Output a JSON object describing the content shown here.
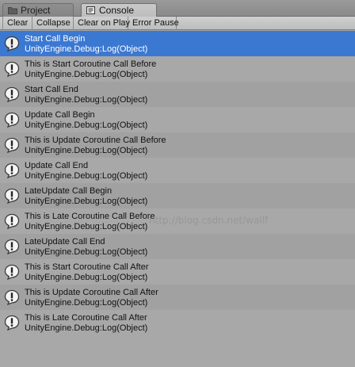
{
  "tabs": [
    {
      "label": "Project",
      "icon": "folder-icon"
    },
    {
      "label": "Console",
      "icon": "console-icon"
    }
  ],
  "toolbar": {
    "clear_label": "Clear",
    "collapse_label": "Collapse",
    "clear_on_play_label": "Clear on Play",
    "error_pause_label": "Error Pause"
  },
  "logs": [
    {
      "message": "Start Call Begin",
      "source": "UnityEngine.Debug:Log(Object)",
      "icon": "info-log-icon",
      "selected": true
    },
    {
      "message": "This is Start Coroutine Call Before",
      "source": "UnityEngine.Debug:Log(Object)",
      "icon": "info-log-icon"
    },
    {
      "message": "Start Call End",
      "source": "UnityEngine.Debug:Log(Object)",
      "icon": "info-log-icon"
    },
    {
      "message": "Update Call Begin",
      "source": "UnityEngine.Debug:Log(Object)",
      "icon": "info-log-icon"
    },
    {
      "message": "This is Update Coroutine Call Before",
      "source": "UnityEngine.Debug:Log(Object)",
      "icon": "info-log-icon"
    },
    {
      "message": "Update Call End",
      "source": "UnityEngine.Debug:Log(Object)",
      "icon": "info-log-icon"
    },
    {
      "message": "LateUpdate Call Begin",
      "source": "UnityEngine.Debug:Log(Object)",
      "icon": "info-log-icon"
    },
    {
      "message": "This is Late Coroutine Call Before",
      "source": "UnityEngine.Debug:Log(Object)",
      "icon": "info-log-icon"
    },
    {
      "message": "LateUpdate Call End",
      "source": "UnityEngine.Debug:Log(Object)",
      "icon": "info-log-icon"
    },
    {
      "message": "This is Start Coroutine Call After",
      "source": "UnityEngine.Debug:Log(Object)",
      "icon": "info-log-icon"
    },
    {
      "message": "This is Update Coroutine Call After",
      "source": "UnityEngine.Debug:Log(Object)",
      "icon": "info-log-icon"
    },
    {
      "message": "This is Late Coroutine Call After",
      "source": "UnityEngine.Debug:Log(Object)",
      "icon": "info-log-icon"
    }
  ],
  "watermark": "http://blog.csdn.net/wallf",
  "colors": {
    "selection": "#3b78d2",
    "row_odd": "#a1a1a1",
    "row_even": "#a8a8a8"
  }
}
